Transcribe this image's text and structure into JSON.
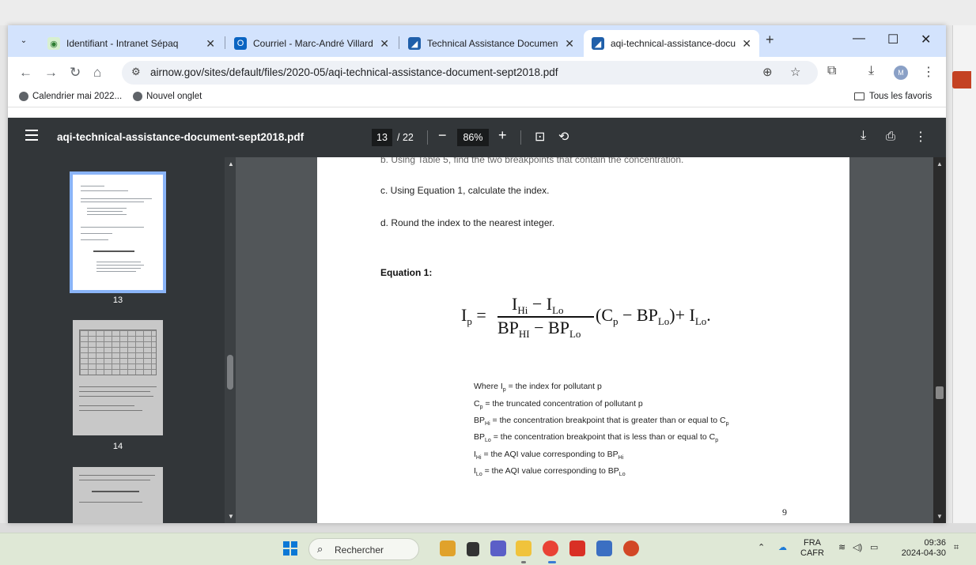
{
  "browser": {
    "tabs": [
      {
        "title": "Identifiant - Intranet Sépaq",
        "active": false
      },
      {
        "title": "Courriel - Marc-André Villard -",
        "active": false
      },
      {
        "title": "Technical Assistance Document",
        "active": false
      },
      {
        "title": "aqi-technical-assistance-docum",
        "active": true
      }
    ],
    "url": "airnow.gov/sites/default/files/2020-05/aqi-technical-assistance-document-sept2018.pdf",
    "bookmarks": [
      "Calendrier mai 2022...",
      "Nouvel onglet"
    ],
    "all_bookmarks_label": "Tous les favoris",
    "avatar_letter": "M"
  },
  "pdf": {
    "filename": "aqi-technical-assistance-document-sept2018.pdf",
    "current_page": "13",
    "total_pages": "/ 22",
    "zoom": "86%",
    "thumbnails": [
      {
        "number": "13",
        "selected": true
      },
      {
        "number": "14",
        "selected": false
      }
    ],
    "page": {
      "top_cut": "b. Using Table 5, find the two breakpoints that contain the concentration.",
      "step_c": "c. Using Equation 1, calculate the index.",
      "step_d": "d. Round the index to the nearest integer.",
      "equation_label": "Equation 1:",
      "page_number": "9"
    }
  },
  "taskbar": {
    "search_label": "Rechercher",
    "language": "FRA",
    "keyboard": "CAFR",
    "time": "09:36",
    "date": "2024-04-30"
  }
}
